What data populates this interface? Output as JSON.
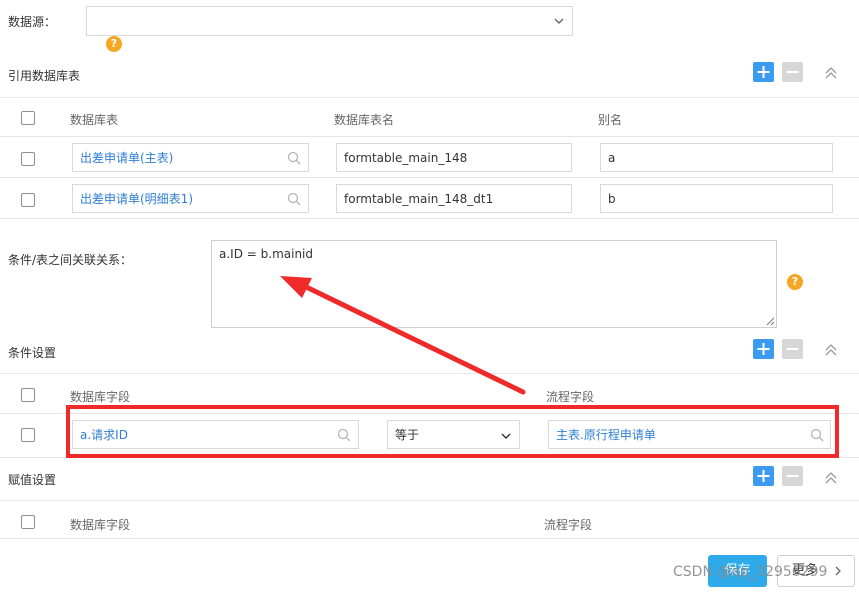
{
  "datasource": {
    "label": "数据源：",
    "value": ""
  },
  "ref_tables": {
    "title": "引用数据库表",
    "headers": [
      "数据库表",
      "数据库表名",
      "别名"
    ],
    "rows": [
      {
        "table": "出差申请单(主表)",
        "table_name": "formtable_main_148",
        "alias": "a"
      },
      {
        "table": "出差申请单(明细表1)",
        "table_name": "formtable_main_148_dt1",
        "alias": "b"
      }
    ]
  },
  "relation": {
    "label": "条件/表之间关联关系：",
    "value": "a.ID = b.mainid"
  },
  "conditions": {
    "title": "条件设置",
    "headers": [
      "数据库字段",
      "流程字段"
    ],
    "row": {
      "db_field": "a.请求ID",
      "operator": "等于",
      "flow_field": "主表.原行程申请单"
    }
  },
  "assign": {
    "title": "赋值设置",
    "headers": [
      "数据库字段",
      "流程字段"
    ]
  },
  "footer": {
    "save_label": "保存",
    "more_label": "更多"
  },
  "watermark": "CSDN @qq_32956299",
  "help_glyph": "?",
  "colors": {
    "accent": "#3b9bf0",
    "highlight": "#ee2a2a",
    "help": "#f6a623",
    "link": "#2f7fd5"
  },
  "icons": [
    "help-icon",
    "search-icon",
    "chevron-down-icon",
    "chevron-up-icon",
    "plus-icon",
    "minus-icon",
    "chevron-right-icon"
  ]
}
